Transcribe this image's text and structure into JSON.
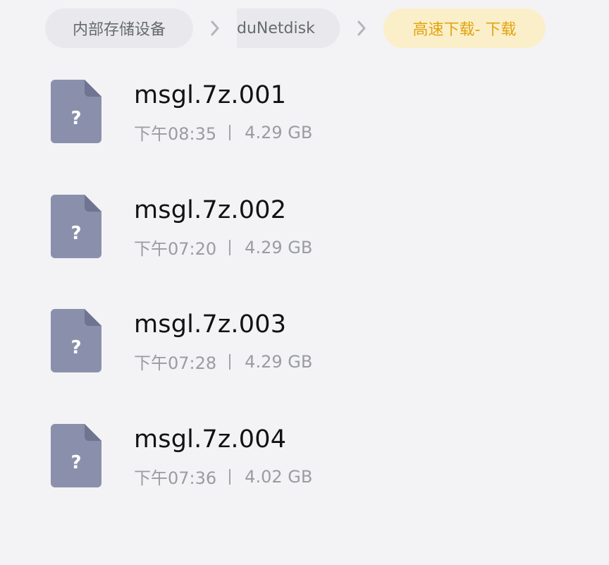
{
  "breadcrumb": {
    "items": [
      {
        "label": "内部存储设备"
      },
      {
        "label": "duNetdisk"
      },
      {
        "label": "高速下载- 下载"
      }
    ]
  },
  "files": [
    {
      "name": "msgl.7z.001",
      "time": "下午08:35",
      "size": "4.29 GB",
      "icon_glyph": "?"
    },
    {
      "name": "msgl.7z.002",
      "time": "下午07:20",
      "size": "4.29 GB",
      "icon_glyph": "?"
    },
    {
      "name": "msgl.7z.003",
      "time": "下午07:28",
      "size": "4.29 GB",
      "icon_glyph": "?"
    },
    {
      "name": "msgl.7z.004",
      "time": "下午07:36",
      "size": "4.02 GB",
      "icon_glyph": "?"
    }
  ],
  "icons": {
    "file": "unknown-file-icon",
    "separator": "chevron-right-icon"
  },
  "colors": {
    "background": "#f3f3f5",
    "crumb_bg": "#e9e9ed",
    "crumb_text": "#666a70",
    "active_crumb_bg": "#fbefc9",
    "active_crumb_text": "#e0a411",
    "file_icon": "#8a90ac",
    "file_icon_fold": "#6f7591"
  }
}
